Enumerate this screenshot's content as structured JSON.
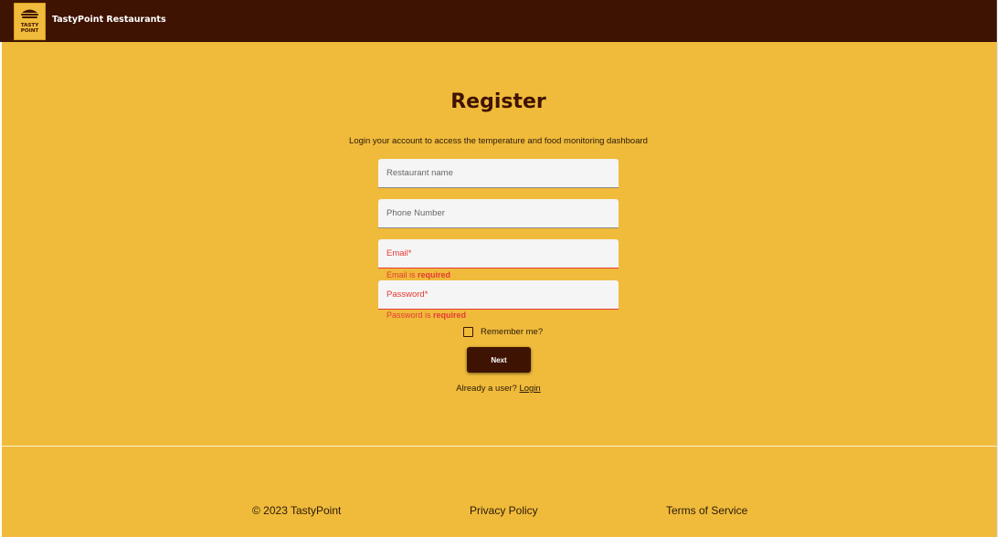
{
  "navbar": {
    "logo_text_line1": "TASTY",
    "logo_text_line2": "POINT",
    "title": "TastyPoint Restaurants"
  },
  "form": {
    "heading": "Register",
    "subtitle": "Login your account to access the temperature and food monitoring dashboard",
    "fields": [
      {
        "placeholder": "Restaurant name",
        "value": ""
      },
      {
        "placeholder": "Phone Number",
        "value": ""
      },
      {
        "placeholder": "Email*",
        "value": "",
        "error_prefix": "Email is ",
        "error_strong": "required"
      },
      {
        "placeholder": "Password*",
        "value": "",
        "error_prefix": "Password is ",
        "error_strong": "required"
      }
    ],
    "remember_label": "Remember me?",
    "remember_checked": false,
    "next_label": "Next",
    "already_text": "Already a user?",
    "login_link": "Login"
  },
  "footer": {
    "copyright": "© 2023 TastyPoint",
    "privacy": "Privacy Policy",
    "terms": "Terms of Service"
  },
  "colors": {
    "primary": "#3f1302",
    "background": "#f0bb3b",
    "error": "#e53935"
  }
}
